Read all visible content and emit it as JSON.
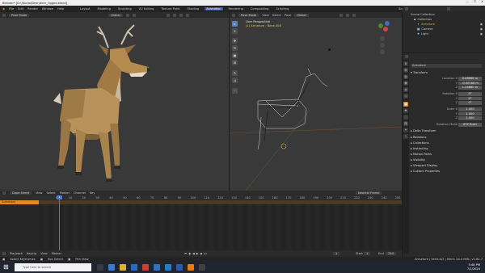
{
  "window": {
    "title": "Blender* [D:\\Studio\\Deer\\deer_rigged.blend]",
    "minimize": "—",
    "maximize": "☐",
    "close": "✕"
  },
  "menu": {
    "items": [
      "File",
      "Edit",
      "Render",
      "Window",
      "Help"
    ],
    "workspaces": [
      "Layout",
      "Modeling",
      "Sculpting",
      "UV Editing",
      "Texture Paint",
      "Shading",
      "Animation",
      "Rendering",
      "Compositing",
      "Scripting"
    ],
    "active_workspace": "Animation",
    "scene": "Scene",
    "view_layer": "View Layer"
  },
  "left_viewport": {
    "mode": "Pose Mode",
    "orientation": "Global"
  },
  "right_viewport": {
    "mode": "Pose Mode",
    "menus": [
      "View",
      "Select",
      "Pose"
    ],
    "orientation": "Global",
    "info_line1": "User Perspective",
    "info_line2": "(1) Armature : Bone.008"
  },
  "outliner": {
    "title": "Scene Collection",
    "items": [
      {
        "name": "Collection"
      },
      {
        "name": "Armature"
      },
      {
        "name": "Camera"
      },
      {
        "name": "Light"
      }
    ]
  },
  "properties": {
    "object_name": "Armature",
    "sections": {
      "transform": "Transform",
      "delta": "Delta Transform",
      "relations": "Relations",
      "collections": "Collections",
      "instancing": "Instancing",
      "motion_paths": "Motion Paths",
      "visibility": "Visibility",
      "viewport_display": "Viewport Display",
      "custom_props": "Custom Properties"
    },
    "location": {
      "label": "Location X",
      "x": "0.08868 m",
      "y": "-0.00168 m",
      "z": "1.28880 m"
    },
    "rotation": {
      "label": "Rotation X",
      "x": "0°",
      "y": "0°",
      "z": "0°"
    },
    "scale": {
      "label": "Scale X",
      "x": "1.000",
      "y": "1.000",
      "z": "1.000"
    },
    "rotation_mode": {
      "label": "Rotation Mode",
      "value": "XYZ Euler"
    }
  },
  "timeline": {
    "mode": "Dope Sheet",
    "menus": [
      "View",
      "Select",
      "Marker",
      "Channel",
      "Key"
    ],
    "filter": "Nearest Frame",
    "summary": "Summary",
    "current_frame": "1",
    "ticks": [
      "0",
      "10",
      "20",
      "30",
      "40",
      "50",
      "60",
      "70",
      "80",
      "90",
      "100",
      "110",
      "120",
      "130",
      "140",
      "150",
      "160",
      "170",
      "180",
      "190",
      "200",
      "210",
      "220",
      "230",
      "240",
      "250"
    ],
    "playback_menus": [
      "Playback",
      "Keying",
      "View",
      "Marker"
    ],
    "frame": "1",
    "start_label": "Start",
    "start": "1",
    "end_label": "End",
    "end": "250"
  },
  "status": {
    "left": [
      "Select Keyframes",
      "Box Select",
      "Pan View"
    ],
    "right": "Armature | Verts:0/2 | Mem: 24.4 MiB | v2.82.7"
  },
  "taskbar": {
    "search": "Type here to search",
    "time": "5:48 PM",
    "date": "7/1/2020"
  },
  "colors": {
    "accent": "#5680c2",
    "active_tab": "#3a5aa0",
    "orange_header": "#e08a22"
  }
}
